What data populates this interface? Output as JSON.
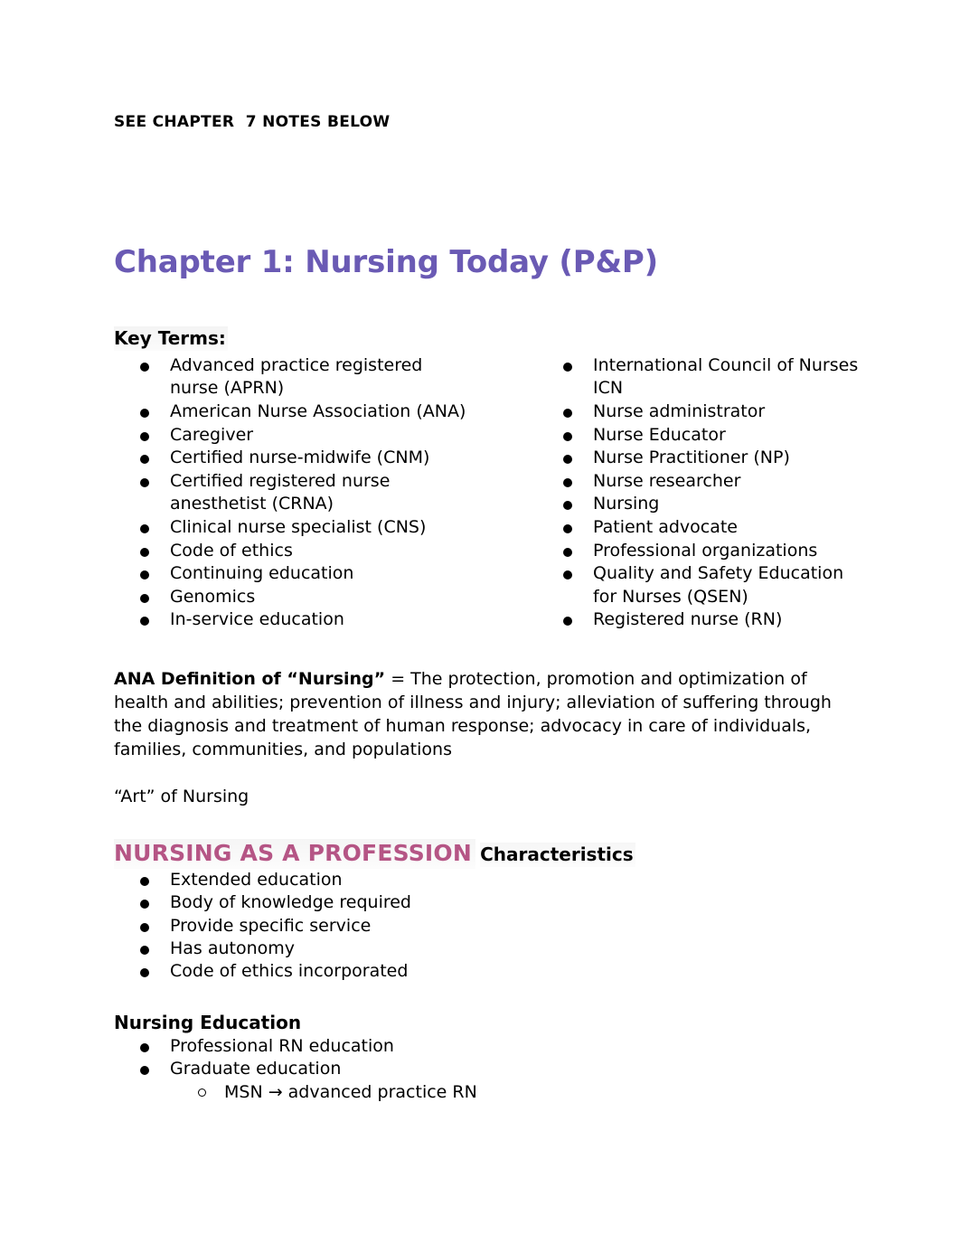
{
  "document": {
    "top_note": "SEE CHAPTER  7 NOTES BELOW",
    "chapter_title": "Chapter 1: Nursing Today (P&P)",
    "title_color": "#6a5ab4",
    "profession_heading_color": "#b55585"
  },
  "key_terms": {
    "heading": "Key Terms:",
    "left_column": [
      "Advanced practice registered nurse (APRN)",
      "American Nurse Association (ANA)",
      "Caregiver",
      "Certified nurse-midwife (CNM)",
      "Certified registered nurse anesthetist (CRNA)",
      "Clinical nurse specialist (CNS)",
      "Code of ethics",
      "Continuing education",
      "Genomics",
      "In-service education"
    ],
    "right_column": [
      "International Council of Nurses ICN",
      "Nurse administrator",
      "Nurse Educator",
      "Nurse Practitioner (NP)",
      "Nurse researcher",
      "Nursing",
      "Patient advocate",
      "Professional organizations",
      "Quality and Safety Education for Nurses (QSEN)",
      "Registered nurse (RN)"
    ]
  },
  "ana_definition": {
    "label": "ANA Definition of “Nursing”",
    "body": " = The protection, promotion and optimization of health and abilities; prevention of illness and injury; alleviation of suffering through the diagnosis and treatment of human response; advocacy in care of individuals, families, communities, and populations"
  },
  "art_of_nursing": "“Art” of Nursing",
  "profession": {
    "heading": "NURSING AS A PROFESSION",
    "characteristics_heading": "Characteristics",
    "characteristics": [
      "Extended education",
      "Body of knowledge required",
      "Provide specific service",
      "Has autonomy",
      "Code of ethics incorporated"
    ]
  },
  "nursing_education": {
    "heading": "Nursing Education",
    "items": [
      "Professional RN education",
      "Graduate education"
    ],
    "sub_items": [
      "MSN → advanced practice RN"
    ]
  }
}
